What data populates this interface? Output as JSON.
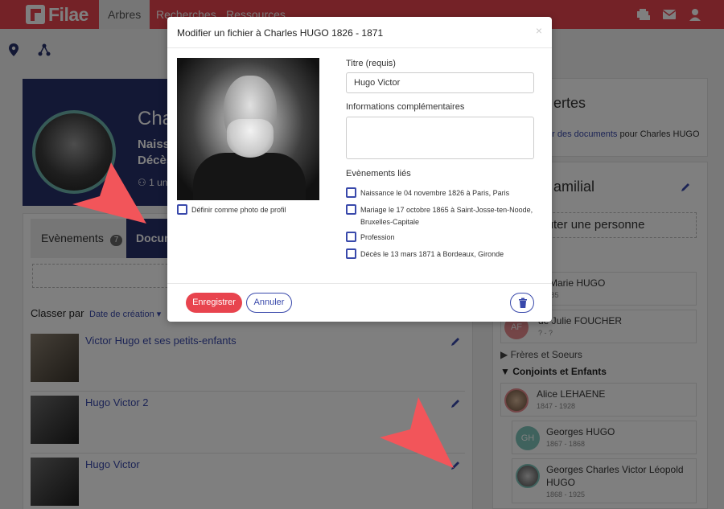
{
  "nav": {
    "logo": "Filae",
    "tabs": [
      {
        "label": "Arbres",
        "active": true
      },
      {
        "label": "Recherches",
        "active": false
      },
      {
        "label": "Ressources",
        "active": false
      }
    ],
    "icons": [
      "add-person-icon",
      "mail-icon",
      "user-icon"
    ]
  },
  "toolbar": {
    "icons": [
      "location-pin-icon",
      "tree-nodes-icon"
    ]
  },
  "profile": {
    "name": "Cha",
    "birth": "Naissa",
    "death": "Décès",
    "small": "1 un"
  },
  "tabs": {
    "events_label": "Evènements",
    "events_count": "7",
    "documents_label": "Docum"
  },
  "sort": {
    "label": "Classer par",
    "value": "Date de création"
  },
  "documents": [
    {
      "title": "Victor Hugo et ses petits-enfants"
    },
    {
      "title": "Hugo Victor 2"
    },
    {
      "title": "Hugo Victor"
    }
  ],
  "right": {
    "discoveries_title": "ertes",
    "discoveries_link": "er des documents",
    "discoveries_text": " pour Charles HUGO",
    "family_title": "amilial",
    "add_person": "jouter une personne",
    "parents": [
      {
        "name": "or Marie HUGO",
        "dates": "- 1885"
      },
      {
        "name": "de Julie FOUCHER",
        "dates": "? - ?",
        "initials": "AF"
      }
    ],
    "siblings_header": "Frères et Soeurs",
    "spouse_header": "Conjoints et Enfants",
    "spouse_children": [
      {
        "name": "Alice LEHAENE",
        "dates": "1847 - 1928"
      },
      {
        "name": "Georges HUGO",
        "dates": "1867 - 1868",
        "initials": "GH"
      },
      {
        "name": "Georges Charles Victor Léopold HUGO",
        "dates": "1868 - 1925"
      }
    ]
  },
  "modal": {
    "title": "Modifier un fichier à Charles HUGO 1826 - 1871",
    "close": "×",
    "profile_photo_label": "Définir comme photo de profil",
    "title_label": "Titre (requis)",
    "title_value": "Hugo Victor",
    "info_label": "Informations complémentaires",
    "info_value": "",
    "events_label": "Evènements liés",
    "events": [
      {
        "label": "Naissance le 04 novembre 1826 à Paris, Paris"
      },
      {
        "label": "Mariage le 17 octobre 1865 à Saint-Josse-ten-Noode, Bruxelles-Capitale"
      },
      {
        "label": "Profession"
      },
      {
        "label": "Décès le 13 mars 1871 à Bordeaux, Gironde"
      }
    ],
    "save_label": "Enregistrer",
    "cancel_label": "Annuler"
  },
  "colors": {
    "brand": "#e8444e",
    "navy": "#27306b",
    "link": "#3949ab",
    "arrow": "#f2555a"
  }
}
